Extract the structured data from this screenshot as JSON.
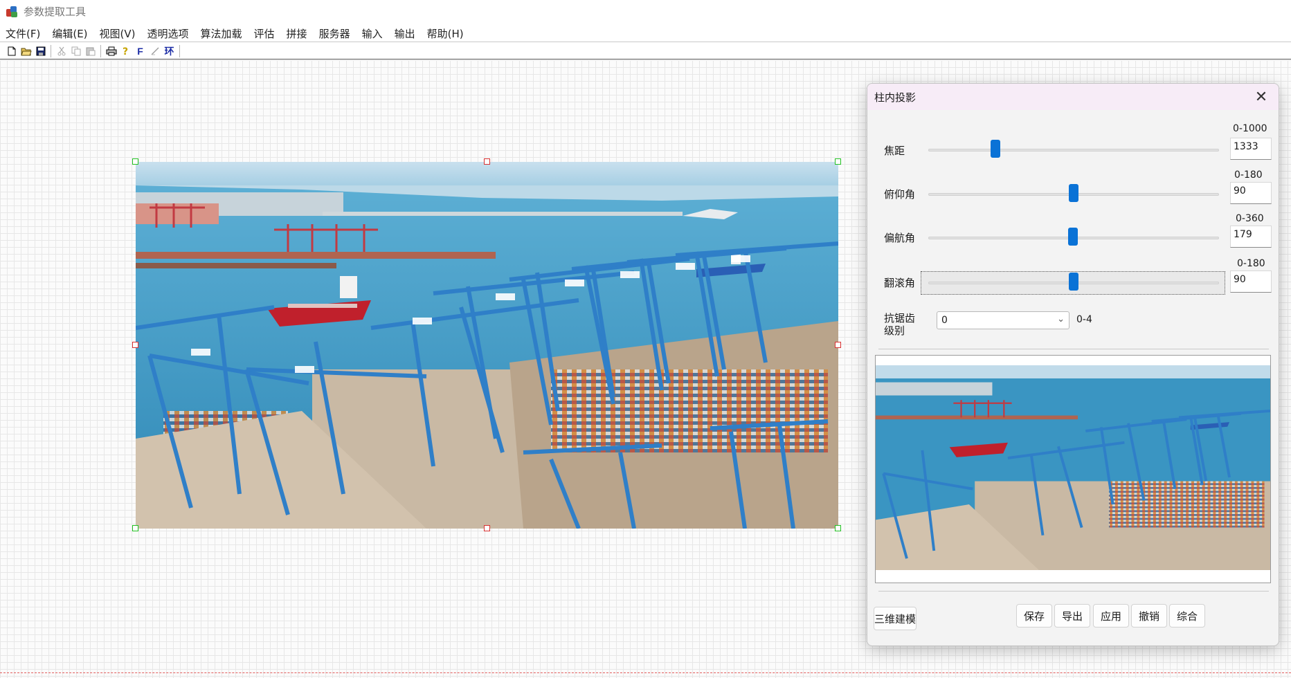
{
  "app": {
    "title": "参数提取工具"
  },
  "menu": [
    {
      "label": "文件(F)"
    },
    {
      "label": "编辑(E)"
    },
    {
      "label": "视图(V)"
    },
    {
      "label": "透明选项"
    },
    {
      "label": "算法加载"
    },
    {
      "label": "评估"
    },
    {
      "label": "拼接"
    },
    {
      "label": "服务器"
    },
    {
      "label": "输入"
    },
    {
      "label": "输出"
    },
    {
      "label": "帮助(H)"
    }
  ],
  "toolbar": {
    "icons": [
      "new-file-icon",
      "open-folder-icon",
      "save-icon",
      "cut-icon",
      "copy-icon",
      "paste-icon",
      "print-icon",
      "help-icon",
      "font-icon",
      "line-icon",
      "ring-icon"
    ],
    "font_glyph": "F",
    "ring_glyph": "环"
  },
  "dialog": {
    "title": "柱内投影",
    "close_glyph": "✕",
    "params": [
      {
        "label": "焦距",
        "range": "0-1000",
        "value": "1333",
        "slider_fraction": 0.23
      },
      {
        "label": "俯仰角",
        "range": "0-180",
        "value": "90",
        "slider_fraction": 0.5
      },
      {
        "label": "偏航角",
        "range": "0-360",
        "value": "179",
        "slider_fraction": 0.497
      },
      {
        "label": "翻滚角",
        "range": "0-180",
        "value": "90",
        "slider_fraction": 0.5
      }
    ],
    "antialias": {
      "label_line1": "抗锯齿",
      "label_line2": "级别",
      "value": "0",
      "range": "0-4"
    },
    "buttons": {
      "model3d": "三维建模",
      "save": "保存",
      "export": "导出",
      "apply": "应用",
      "undo": "撤销",
      "combine": "综合"
    }
  },
  "colors": {
    "slider_thumb": "#0a72d6",
    "handle_corner": "#22c022",
    "handle_mid": "#d83030"
  }
}
